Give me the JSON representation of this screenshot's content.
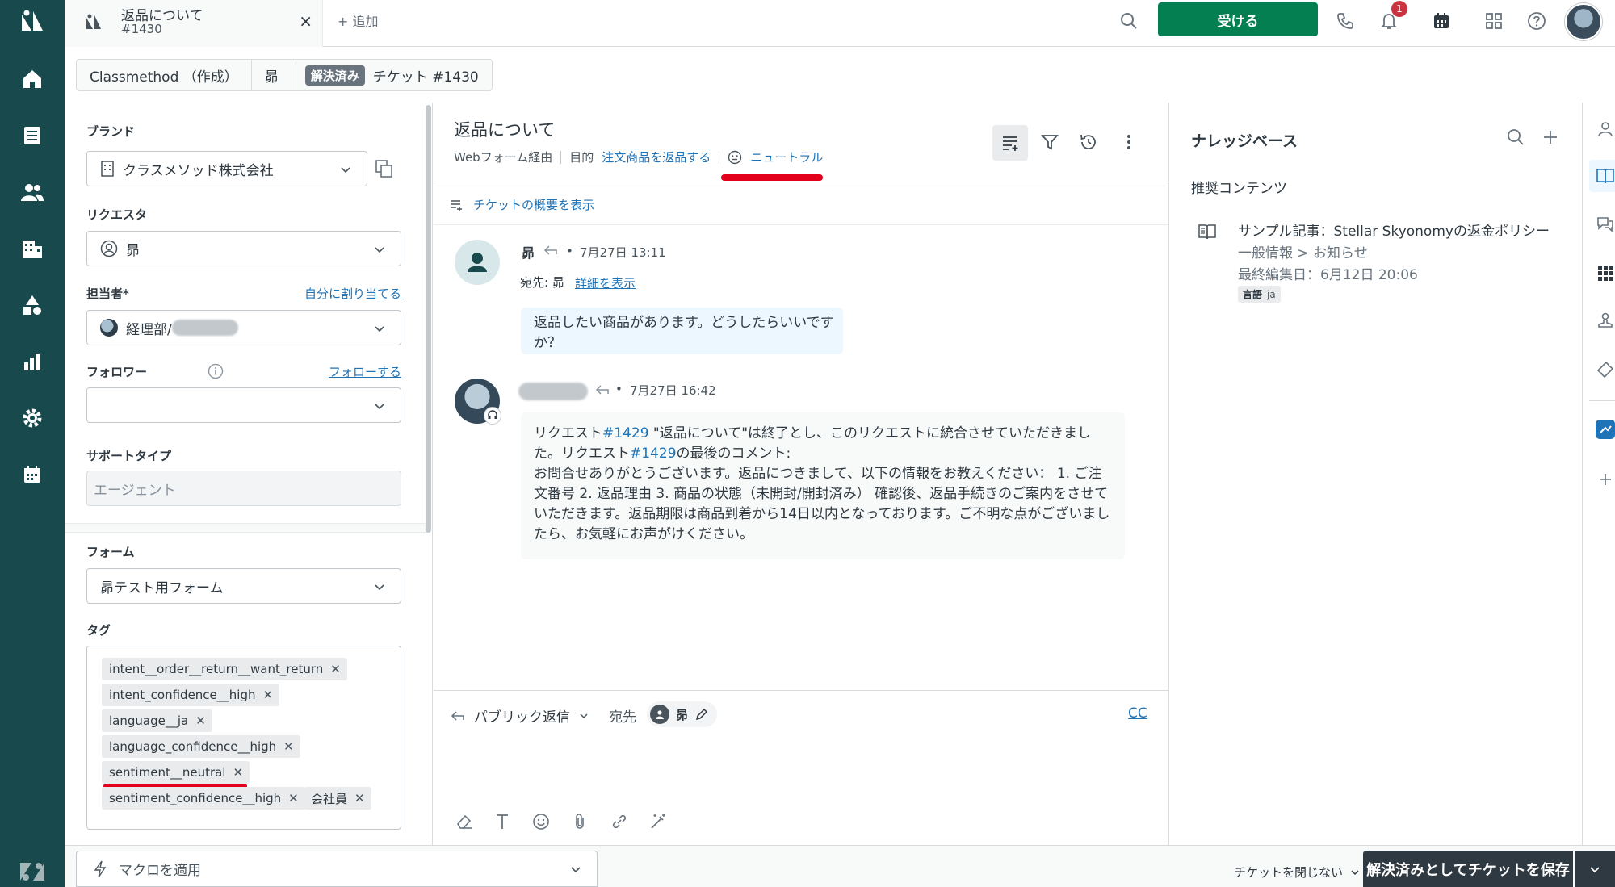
{
  "tab": {
    "title": "返品について",
    "subtitle": "#1430",
    "close": "×",
    "add": "+ 追加"
  },
  "header": {
    "accept_label": "受ける",
    "notification_count": "1"
  },
  "breadcrumb": {
    "org": "Classmethod （作成）",
    "requester": "昴",
    "status": "解決済み",
    "ticket": "チケット #1430"
  },
  "props": {
    "brand_label": "ブランド",
    "brand_value": "クラスメソッド株式会社",
    "requester_label": "リクエスタ",
    "requester_value": "昴",
    "assignee_label": "担当者*",
    "assign_self": "自分に割り当てる",
    "assignee_value": "経理部/",
    "follower_label": "フォロワー",
    "follow_link": "フォローする",
    "follower_value": "",
    "support_type_label": "サポートタイプ",
    "support_type_value": "エージェント",
    "form_label": "フォーム",
    "form_value": "昴テスト用フォーム",
    "tags_label": "タグ",
    "tags": [
      "intent__order__return__want_return",
      "intent_confidence__high",
      "language__ja",
      "language_confidence__high",
      "sentiment__neutral",
      "sentiment_confidence__high",
      "会社員"
    ]
  },
  "ticket": {
    "title": "返品について",
    "channel": "Webフォーム経由",
    "intent_label": "目的",
    "intent_value": "注文商品を返品する",
    "sentiment": "ニュートラル",
    "summary_link": "チケットの概要を表示"
  },
  "messages": [
    {
      "author": "昴",
      "time": "7月27日 13:11",
      "to_label": "宛先: 昴",
      "details_link": "詳細を表示",
      "body": "返品したい商品があります。どうしたらいいですか？"
    },
    {
      "author": "",
      "time": "7月27日 16:42",
      "body_parts": [
        "リクエスト",
        "#1429",
        " \"返品について\"は終了とし、このリクエストに統合させていただきました。リクエスト",
        "#1429",
        "の最後のコメント:"
      ],
      "body_rest": "お問合せありがとうございます。返品につきまして、以下の情報をお教えください： 1. ご注文番号 2. 返品理由 3. 商品の状態（未開封/開封済み） 確認後、返品手続きのご案内をさせていただきます。返品期限は商品到着から14日以内となっております。ご不明な点がございましたら、お気軽にお声がけください。"
    }
  ],
  "composer": {
    "mode": "パブリック返信",
    "to_label": "宛先",
    "recipient": "昴",
    "cc": "CC"
  },
  "kb": {
    "title": "ナレッジベース",
    "section": "推奨コンテンツ",
    "article_title": "サンプル記事：Stellar Skyonomyの返金ポリシー",
    "article_path": "一般情報 > お知らせ",
    "article_edited": "最終編集日：6月12日 20:06",
    "lang_label": "言語",
    "lang_value": "ja"
  },
  "bottom": {
    "macro": "マクロを適用",
    "close_toggle": "チケットを閉じない",
    "submit": "解決済みとしてチケットを保存"
  },
  "colors": {
    "nav": "#17494d",
    "accept": "#037f52",
    "link": "#1f73b7",
    "highlight": "#e3001b",
    "submit": "#2f3941"
  }
}
